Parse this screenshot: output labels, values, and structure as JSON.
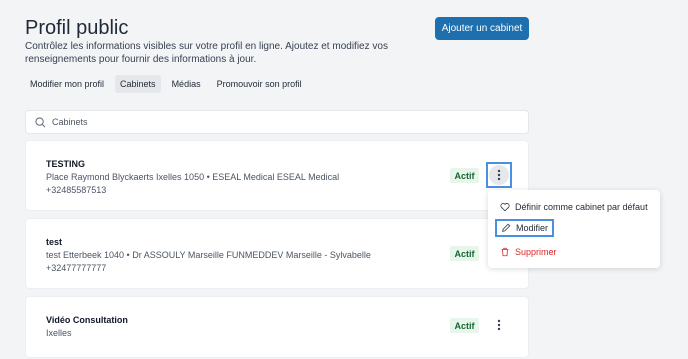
{
  "header": {
    "title": "Profil public",
    "description": "Contrôlez les informations visibles sur votre profil en ligne. Ajoutez et modifiez vos renseignements pour fournir des informations à jour.",
    "add_button": "Ajouter un cabinet"
  },
  "tabs": [
    {
      "label": "Modifier mon profil",
      "active": false
    },
    {
      "label": "Cabinets",
      "active": true
    },
    {
      "label": "Médias",
      "active": false
    },
    {
      "label": "Promouvoir son profil",
      "active": false
    }
  ],
  "search": {
    "placeholder": "Cabinets",
    "icon": "search-icon"
  },
  "cabinets": [
    {
      "name": "TESTING",
      "line1": "Place Raymond Blyckaerts Ixelles 1050  •  ESEAL Medical ESEAL Medical",
      "line2": "+32485587513",
      "status": "Actif"
    },
    {
      "name": "test",
      "line1": "test Etterbeek 1040  •  Dr ASSOULY Marseille FUNMEDDEV Marseille - Sylvabelle",
      "line2": "+32477777777",
      "status": "Actif"
    },
    {
      "name": "Vidéo Consultation",
      "line1": "Ixelles",
      "line2": "",
      "status": "Actif"
    }
  ],
  "menu": {
    "items": [
      {
        "label": "Définir comme cabinet par défaut",
        "icon": "heart-icon"
      },
      {
        "label": "Modifier",
        "icon": "pencil-icon"
      },
      {
        "label": "Supprimer",
        "icon": "trash-icon"
      }
    ]
  },
  "colors": {
    "primary": "#1d6fae",
    "active_badge_bg": "#e7f5ea",
    "active_badge_text": "#166534",
    "danger": "#dc2626",
    "focus_ring": "#4a90e2"
  }
}
